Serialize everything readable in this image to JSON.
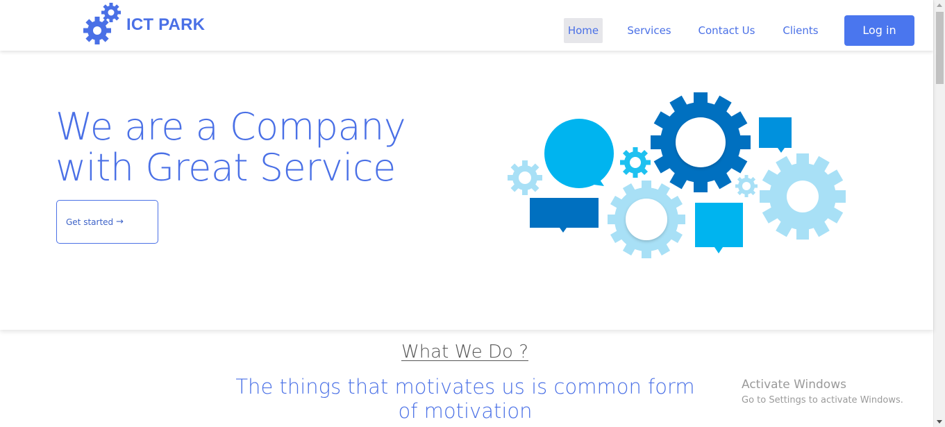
{
  "header": {
    "brand": "ICT PARK",
    "logo_icon": "gears-icon",
    "nav": [
      {
        "label": "Home",
        "active": true
      },
      {
        "label": "Services",
        "active": false
      },
      {
        "label": "Contact Us",
        "active": false
      },
      {
        "label": "Clients",
        "active": false
      }
    ],
    "login_label": "Log in"
  },
  "hero": {
    "title_line1": "We are a Company",
    "title_line2": "with Great Service",
    "cta_label": "Get started",
    "cta_icon": "arrow-right-icon",
    "illustration": "gears-and-speech-bubbles-illustration"
  },
  "section": {
    "title": "What We Do ?",
    "subtitle": "The things that motivates us is common form of motivation"
  },
  "watermark": {
    "line1": "Activate Windows",
    "line2": "Go to Settings to activate Windows."
  },
  "colors": {
    "brand": "#4a70e6",
    "button": "#4a76ee",
    "dark_blue": "#0070c0",
    "cyan": "#00b4ef",
    "light_blue": "#a8e0f6"
  }
}
